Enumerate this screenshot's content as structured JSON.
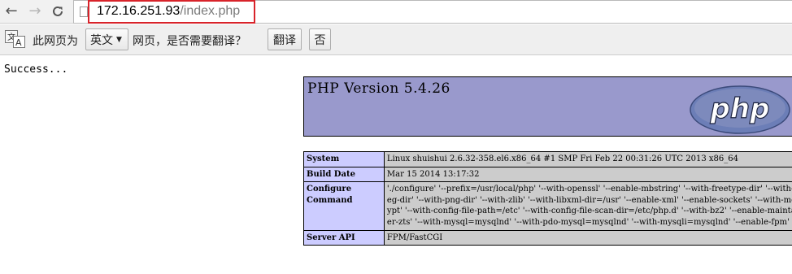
{
  "browser": {
    "url_host": "172.16.251.93",
    "url_path": "/index.php",
    "nav": {
      "back_icon": "arrow-left-icon",
      "forward_icon": "arrow-right-icon",
      "reload_icon": "reload-icon"
    }
  },
  "translate_bar": {
    "prompt_prefix": "此网页为",
    "language": "英文",
    "prompt_suffix": "网页，是否需要翻译？",
    "translate_button": "翻译",
    "no_button": "否"
  },
  "page": {
    "status_text": "Success...",
    "php_title": "PHP Version 5.4.26",
    "logo_text": "php",
    "info_rows": [
      {
        "key": "System",
        "value": "Linux shuishui 2.6.32-358.el6.x86_64 #1 SMP Fri Feb 22 00:31:26 UTC 2013 x86_64"
      },
      {
        "key": "Build Date",
        "value": "Mar 15 2014 13:17:32"
      },
      {
        "key": "Configure Command",
        "value": "'./configure' '--prefix=/usr/local/php' '--with-openssl' '--enable-mbstring' '--with-freetype-dir' '--with-jpeg-dir' '--with-png-dir' '--with-zlib' '--with-libxml-dir=/usr' '--enable-xml' '--enable-sockets' '--with-mcrypt' '--with-config-file-path=/etc' '--with-config-file-scan-dir=/etc/php.d' '--with-bz2' '--enable-maintainer-zts' '--with-mysql=mysqlnd' '--with-pdo-mysql=mysqlnd' '--with-mysqli=mysqlnd' '--enable-fpm'"
      },
      {
        "key": "Server API",
        "value": "FPM/FastCGI"
      }
    ]
  }
}
